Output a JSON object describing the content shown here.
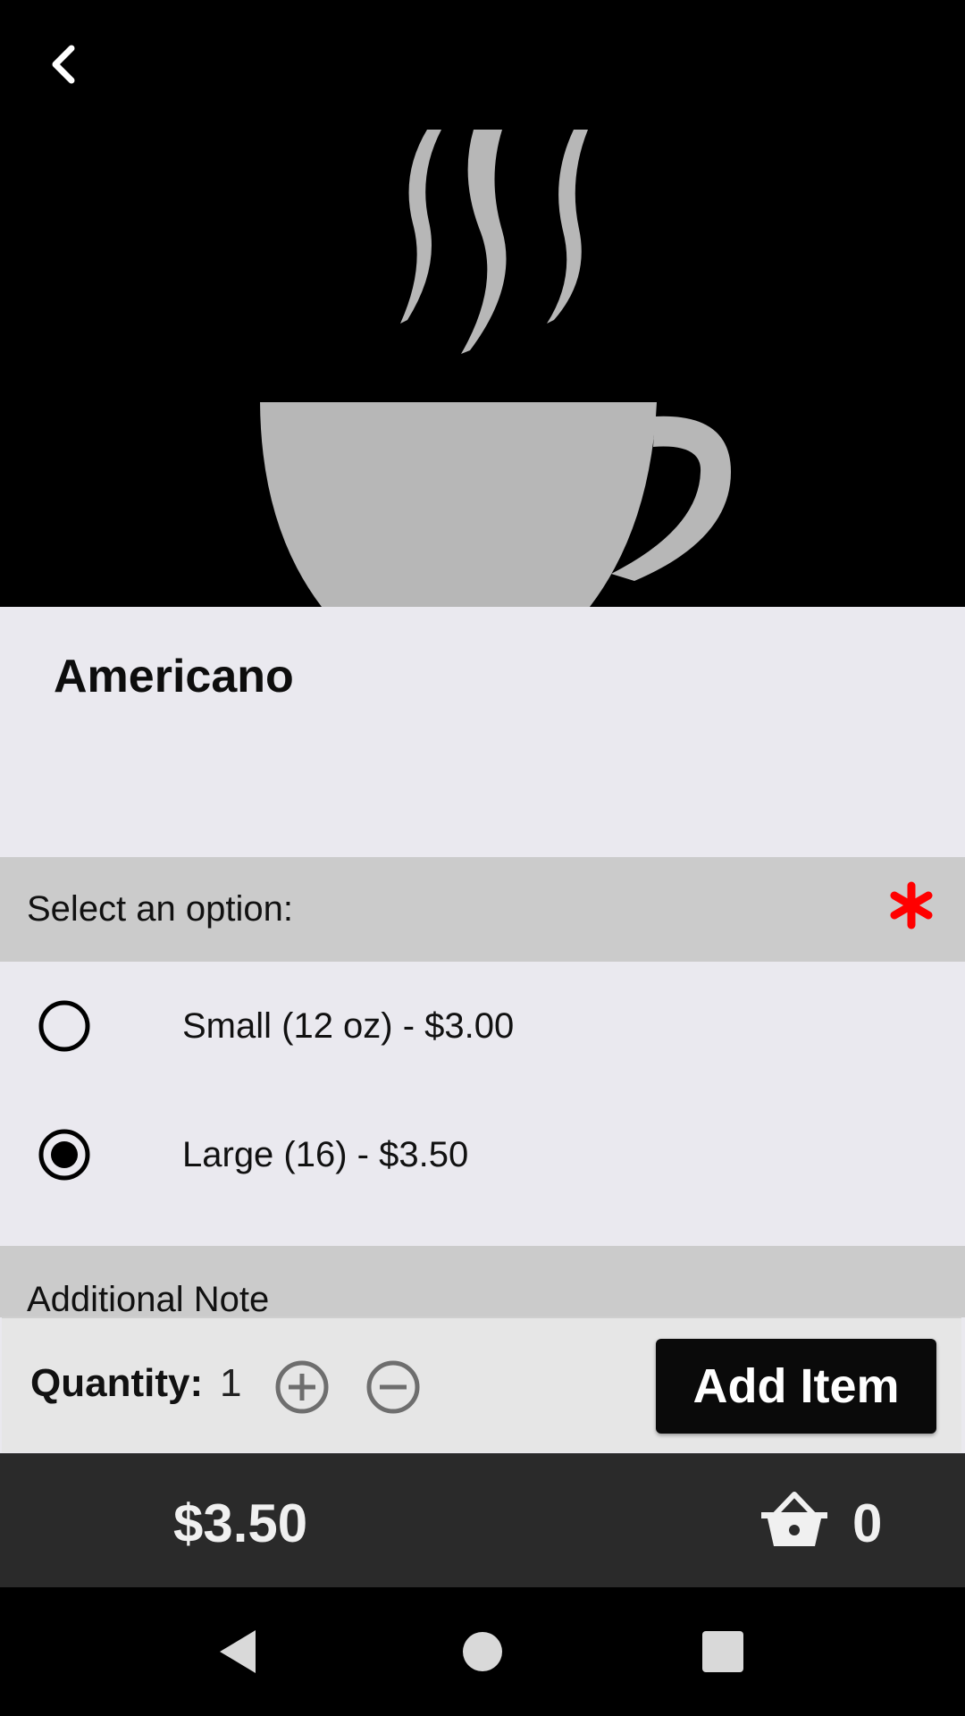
{
  "product": {
    "name": "Americano"
  },
  "options": {
    "header": "Select an option:",
    "required": true,
    "required_color": "#ff0000",
    "items": [
      {
        "label": "Small (12 oz) - $3.00",
        "selected": false
      },
      {
        "label": "Large (16) - $3.50",
        "selected": true
      }
    ]
  },
  "note": {
    "header": "Additional Note"
  },
  "quantity": {
    "label": "Quantity:",
    "value": "1"
  },
  "actions": {
    "add_item_label": "Add Item"
  },
  "footer": {
    "total": "$3.50",
    "cart_count": "0"
  },
  "icons": {
    "back": "chevron-left-icon",
    "hero": "coffee-cup-icon",
    "required": "asterisk-icon",
    "plus": "plus-circle-icon",
    "minus": "minus-circle-icon",
    "cart": "basket-icon"
  },
  "colors": {
    "hero_bg": "#000000",
    "cup": "#b7b7b7",
    "page_bg": "#eae9ef",
    "section_header_bg": "#cbcbcb",
    "button_bg": "#0a0a0a",
    "footer_bg": "#2a2a2a"
  }
}
